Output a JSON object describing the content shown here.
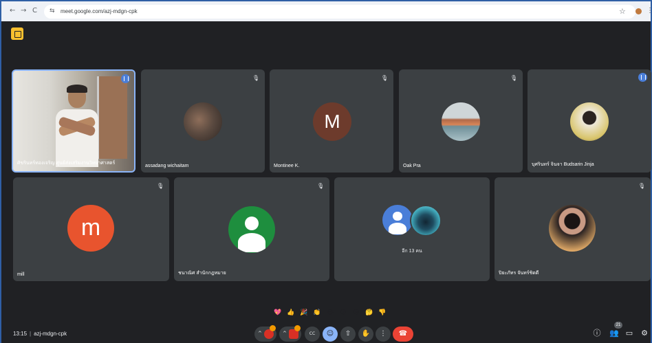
{
  "browser": {
    "url": "meet.google.com/azj-mdgn-cpk",
    "back_glyph": "←",
    "forward_glyph": "→",
    "reload_glyph": "C",
    "tune_glyph": "⇆",
    "star_glyph": "☆",
    "menu_glyph": "⋮"
  },
  "tiles": {
    "self": {
      "name": "ศิขรินทร์ทองเจริญ ศูนย์ส่งเสริมงานวิทยาศาสตร์"
    },
    "assadang": {
      "name": "assadang wichaitam"
    },
    "montinee": {
      "name": "Montinee K.",
      "initial": "M",
      "avatar_color": "#6d3b2c"
    },
    "oak": {
      "name": "Oak Pra"
    },
    "budsarin": {
      "name": "บุศรินทร์ จินจา Budsarin Jinja"
    },
    "mill": {
      "name": "mill",
      "initial": "m",
      "avatar_color": "#e8542e"
    },
    "office": {
      "name": "ชนาณิศ สำนักกฎหมาย"
    },
    "more": {
      "label": "อีก 13 คน"
    },
    "last": {
      "name": "ปิยะภัทร จันทร์ชิดดี"
    }
  },
  "mute_glyph": "🎙",
  "reactions": [
    "💖",
    "👍",
    "🎉",
    "👏",
    "😂",
    "😮",
    "😢",
    "🤔",
    "👎"
  ],
  "meeting": {
    "time": "13:15",
    "separator": "|",
    "code": "azj-mdgn-cpk"
  },
  "controls": {
    "arrow_glyph": "^",
    "caption_glyph": "CC",
    "emoji_glyph": "☺",
    "present_glyph": "⇧",
    "hand_glyph": "✋",
    "more_glyph": "⋮",
    "end_glyph": "☎"
  },
  "right_panel": {
    "info_glyph": "ⓘ",
    "people_glyph": "👥",
    "people_count": "21",
    "chat_glyph": "▭",
    "activities_glyph": "⚙"
  },
  "colors": {
    "background": "#202124",
    "tile": "#3c4043",
    "end_call": "#ea4335",
    "accent": "#8ab4f8",
    "badge": "#f29900",
    "notes_button": "#f9c02f"
  }
}
